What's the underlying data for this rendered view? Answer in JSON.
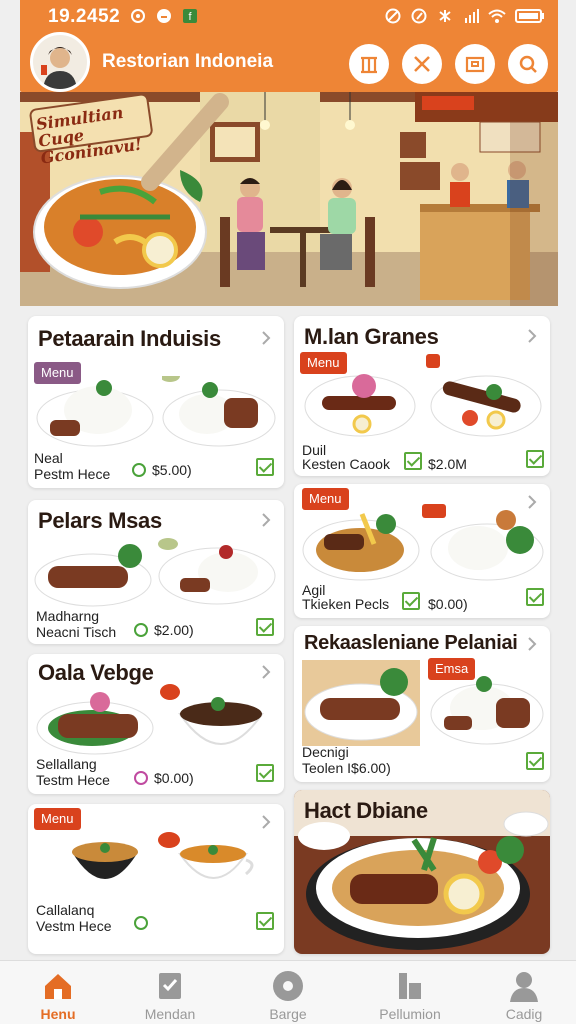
{
  "status": {
    "time": "19.24 52",
    "time_display": "19.2452"
  },
  "header": {
    "title": "Restorian Indoneia"
  },
  "hero": {
    "banner_text": "Simultian Cuqe Gconinavu!"
  },
  "cards": [
    {
      "title": "Petaarain Induisis",
      "badge": "Menu",
      "item_name": "Neal",
      "item_sub": "Pestm Hece",
      "price": "$5.00)"
    },
    {
      "title": "M.lan Granes",
      "badge": "Menu",
      "item_name": "Duil",
      "item_sub": "Kesten Caook",
      "price": "$2.0M"
    },
    {
      "title": "Pelars Msas",
      "item_name": "Madharng",
      "item_sub": "Neacni Tisch",
      "price": "$2.00)"
    },
    {
      "title": "",
      "badge": "Menu",
      "item_name": "Agil",
      "item_sub": "Tkieken Pecls",
      "price": "$0.00)"
    },
    {
      "title": "Oala Vebge",
      "item_name": "Sellallang",
      "item_sub": "Testm Hece",
      "price": "$0.00)"
    },
    {
      "title": "Rekaasleniane Pelaniai",
      "badge": "Emsa",
      "item_name": "Decnigi",
      "item_sub": "Teolen I$6.00)"
    },
    {
      "title": "",
      "badge": "Menu",
      "item_name": "Callalanq",
      "item_sub": "Vestm Hece"
    },
    {
      "title": "Hact Dbiane"
    }
  ],
  "nav": [
    {
      "label": "Henu",
      "icon": "home-icon",
      "active": true
    },
    {
      "label": "Mendan",
      "icon": "menu-check-icon"
    },
    {
      "label": "Barge",
      "icon": "disc-icon"
    },
    {
      "label": "Pellumion",
      "icon": "chart-icon"
    },
    {
      "label": "Cadig",
      "icon": "person-icon"
    }
  ],
  "colors": {
    "accent": "#ee8536",
    "badge_red": "#d9421d",
    "badge_purple": "#8a5a86",
    "check_green": "#5aaa3a"
  }
}
